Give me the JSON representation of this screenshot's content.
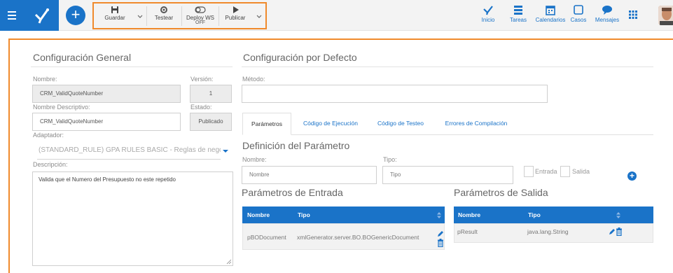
{
  "toolbar": {
    "save_label": "Guardar",
    "test_label": "Testear",
    "deploy_label": "Deploy WS",
    "deploy_sub": "OFF",
    "publish_label": "Publicar"
  },
  "nav": {
    "home_label": "Inicio",
    "tasks_label": "Tareas",
    "calendars_label": "Calendarios",
    "cases_label": "Casos",
    "messages_label": "Mensajes"
  },
  "general": {
    "title": "Configuración General",
    "name_label": "Nombre:",
    "name_value": "CRM_ValidQuoteNumber",
    "version_label": "Versión:",
    "version_value": "1",
    "descriptive_name_label": "Nombre Descriptivo:",
    "descriptive_name_value": "CRM_ValidQuoteNumber",
    "state_label": "Estado:",
    "state_value": "Publicado",
    "adapter_label": "Adaptador:",
    "adapter_value": "(STANDARD_RULE) GPA RULES BASIC - Reglas de nego",
    "description_label": "Descripción:",
    "description_value": "Valida que el Numero del Presupuesto  no este repetido"
  },
  "defaults": {
    "title": "Configuración por Defecto",
    "method_label": "Método:",
    "method_value": ""
  },
  "tabs": [
    {
      "label": "Parámetros"
    },
    {
      "label": "Código de Ejecución"
    },
    {
      "label": "Código de Testeo"
    },
    {
      "label": "Errores de Compilación"
    }
  ],
  "param_def": {
    "title": "Definición del Parámetro",
    "name_label": "Nombre:",
    "name_placeholder": "Nombre",
    "type_label": "Tipo:",
    "type_placeholder": "Tipo",
    "input_label": "Entrada",
    "output_label": "Salida"
  },
  "input_params": {
    "title": "Parámetros de Entrada",
    "columns": [
      "Nombre",
      "Tipo"
    ],
    "rows": [
      {
        "name": "pBODocument",
        "type": "xmlGenerator.server.BO.BOGenericDocument"
      }
    ]
  },
  "output_params": {
    "title": "Parámetros de Salida",
    "columns": [
      "Nombre",
      "Tipo"
    ],
    "rows": [
      {
        "name": "pResult",
        "type": "java.lang.String"
      }
    ]
  },
  "colors": {
    "primary": "#1a73c8",
    "highlight": "#f08a2c"
  }
}
